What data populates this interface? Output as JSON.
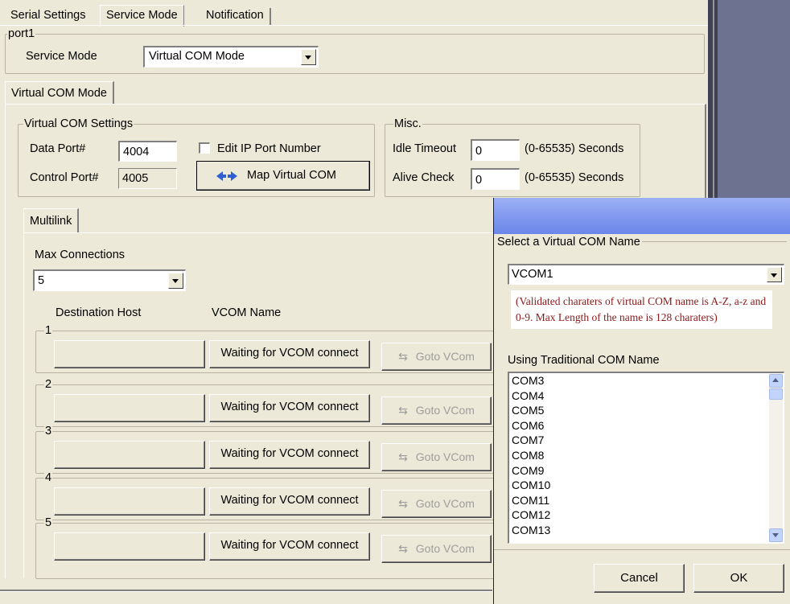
{
  "tabs": [
    {
      "label": "Serial Settings",
      "active": false
    },
    {
      "label": "Service Mode",
      "active": true
    },
    {
      "label": "Notification",
      "active": false
    }
  ],
  "port_group": {
    "legend": "port1",
    "service_mode_label": "Service Mode",
    "service_mode_value": "Virtual COM Mode"
  },
  "mode_tab": {
    "label": "Virtual COM Mode"
  },
  "vcom_settings": {
    "legend": "Virtual COM Settings",
    "data_port_label": "Data Port#",
    "data_port_value": "4004",
    "control_port_label": "Control Port#",
    "control_port_value": "4005",
    "edit_ip_label": "Edit IP Port Number",
    "edit_ip_checked": false,
    "map_button_label": "Map Virtual COM"
  },
  "misc": {
    "legend": "Misc.",
    "idle_timeout_label": "Idle Timeout",
    "idle_timeout_value": "0",
    "idle_timeout_unit": "(0-65535) Seconds",
    "alive_check_label": "Alive Check",
    "alive_check_value": "0",
    "alive_check_unit": "(0-65535) Seconds"
  },
  "multilink": {
    "tab_label": "Multilink",
    "max_connections_label": "Max Connections",
    "max_connections_value": "5",
    "dest_host_header": "Destination Host",
    "vcom_name_header": "VCOM Name",
    "rows": [
      {
        "number": "1",
        "host": "",
        "vcom_button": "Waiting for VCOM connect",
        "goto_button": "Goto VCom"
      },
      {
        "number": "2",
        "host": "",
        "vcom_button": "Waiting for VCOM connect",
        "goto_button": "Goto VCom"
      },
      {
        "number": "3",
        "host": "",
        "vcom_button": "Waiting for VCOM connect",
        "goto_button": "Goto VCom"
      },
      {
        "number": "4",
        "host": "",
        "vcom_button": "Waiting for VCOM connect",
        "goto_button": "Goto VCom"
      },
      {
        "number": "5",
        "host": "",
        "vcom_button": "Waiting for VCOM connect",
        "goto_button": "Goto VCom"
      }
    ]
  },
  "dialog": {
    "title": "",
    "select_legend": "Select a Virtual COM Name",
    "selected_vcom": "VCOM1",
    "note": "(Validated charaters of virtual COM name is A-Z, a-z and 0-9. Max Length of the name is 128 charaters)",
    "traditional_label": "Using Traditional COM Name",
    "com_list": [
      "COM3",
      "COM4",
      "COM5",
      "COM6",
      "COM7",
      "COM8",
      "COM9",
      "COM10",
      "COM11",
      "COM12",
      "COM13"
    ],
    "cancel_label": "Cancel",
    "ok_label": "OK"
  },
  "colors": {
    "dialog_title_gradient_start": "#9db0f5",
    "dialog_title_gradient_end": "#6a86e8",
    "note_text": "#8b1a1a",
    "window_face": "#ece9d8"
  }
}
